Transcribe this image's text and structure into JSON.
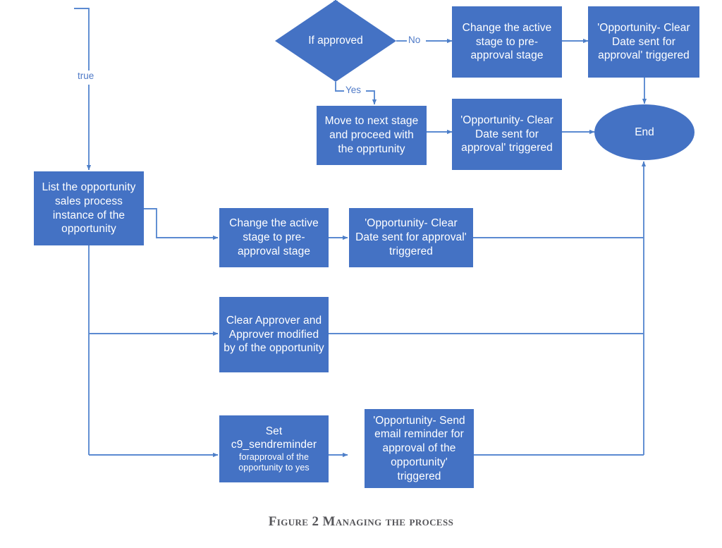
{
  "figure": {
    "caption": "Figure 2 Managing the process",
    "colors": {
      "node_fill": "#4472C4",
      "node_text": "#FFFFFF",
      "connector": "#5B8AD1",
      "caption_text": "#56565A",
      "background": "#FFFFFF"
    }
  },
  "nodes": {
    "decision_if_approved": {
      "label": "If approved",
      "shape": "diamond"
    },
    "change_stage_top": {
      "label": "Change the active stage to pre-approval stage",
      "shape": "process"
    },
    "clear_date_trigger_top": {
      "label": "'Opportunity- Clear Date sent for approval' triggered",
      "shape": "process"
    },
    "move_next_stage": {
      "label": "Move to next stage and proceed with the opprtunity",
      "shape": "process"
    },
    "clear_date_trigger_mid": {
      "label": "'Opportunity- Clear Date sent for approval' triggered",
      "shape": "process"
    },
    "end": {
      "label": "End",
      "shape": "terminator"
    },
    "list_opportunity": {
      "label": "List the opportunity sales process instance of the opportunity",
      "shape": "process"
    },
    "change_stage_lower": {
      "label": "Change the active stage to pre-approval stage",
      "shape": "process"
    },
    "clear_date_trigger_lower": {
      "label": "'Opportunity- Clear Date sent for approval' triggered",
      "shape": "process"
    },
    "clear_approver": {
      "label": "Clear Approver and Approver modified by of the opportunity",
      "shape": "process"
    },
    "set_sendreminder": {
      "line1": "Set",
      "line2": "c9_sendreminder",
      "line3": "forapproval of the",
      "line4": "opportunity to yes",
      "shape": "process"
    },
    "send_email_trigger": {
      "label": "'Opportunity- Send email reminder for approval of the opportunity' triggered",
      "shape": "process"
    }
  },
  "edge_labels": {
    "true": "true",
    "no": "No",
    "yes": "Yes"
  }
}
